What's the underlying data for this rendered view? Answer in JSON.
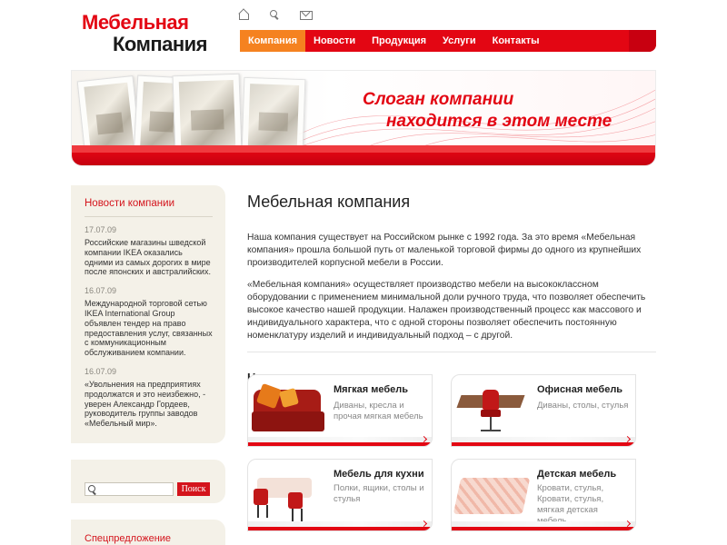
{
  "logo": {
    "line1": "Мебельная",
    "line2": "Компания"
  },
  "top_icons": [
    "home-icon",
    "search-icon",
    "mail-icon"
  ],
  "nav": {
    "items": [
      {
        "label": "Компания",
        "active": true
      },
      {
        "label": "Новости",
        "active": false
      },
      {
        "label": "Продукция",
        "active": false
      },
      {
        "label": "Услуги",
        "active": false
      },
      {
        "label": "Контакты",
        "active": false
      }
    ]
  },
  "banner": {
    "slogan_line1": "Слоган компании",
    "slogan_line2": "находится в этом месте"
  },
  "sidebar": {
    "news_title": "Новости компании",
    "news": [
      {
        "date": "17.07.09",
        "text": "Российские магазины шведской компании IKEA оказались одними из самых дорогих в мире после японских и австралийских."
      },
      {
        "date": "16.07.09",
        "text": "Международной торговой сетью IKEA International Group объявлен тендер на право предоставления услуг, связанных с коммуникационным обслуживанием компании."
      },
      {
        "date": "16.07.09",
        "text": "«Увольнения на предприятиях продолжатся и это неизбежно, - уверен Александр Гордеев, руководитель группы заводов «Мебельный мир»."
      }
    ],
    "search": {
      "placeholder": "",
      "button_label": "Поиск"
    },
    "special_title": "Спецпредложение"
  },
  "main": {
    "title": "Мебельная компания",
    "paragraphs": [
      "Наша компания существует на Российском рынке с 1992 года. За это время «Мебельная компания» прошла большой путь от маленькой торговой фирмы до одного из крупнейших производителей корпусной мебели в России.",
      "«Мебельная компания» осуществляет производство мебели на высококлассном оборудовании с применением минимальной доли ручного труда, что позволяет обеспечить высокое качество нашей продукции. Налажен производственный процесс как массового и индивидуального характера, что с одной стороны позволяет обеспечить постоянную номенклатуру изделий и индивидуальный подход – с другой."
    ],
    "products_title": "Наша продукция",
    "products": [
      {
        "title": "Мягкая мебель",
        "desc": "Диваны, кресла и прочая мягкая мебель"
      },
      {
        "title": "Офисная мебель",
        "desc": "Диваны, столы, стулья"
      },
      {
        "title": "Мебель для кухни",
        "desc": "Полки, ящики, столы и стулья"
      },
      {
        "title": "Детская мебель",
        "desc": "Кровати, стулья, Кровати, стулья, мягкая детская мебель"
      }
    ]
  },
  "colors": {
    "brand_red": "#e30613",
    "nav_active": "#f58220",
    "sidebar_bg": "#f4f1e8"
  }
}
